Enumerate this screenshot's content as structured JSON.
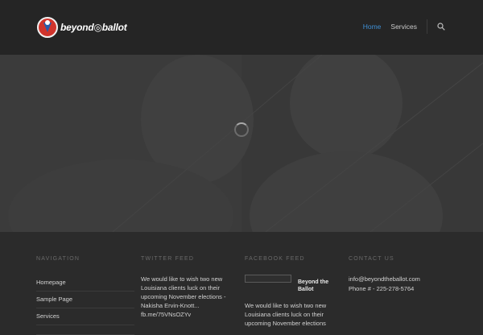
{
  "header": {
    "logo_text": "beyond◎ballot",
    "nav": [
      {
        "label": "Home",
        "active": true
      },
      {
        "label": "Services",
        "active": false
      }
    ],
    "accent": "#3f8fd4"
  },
  "footer": {
    "navigation": {
      "title": "NAVIGATION",
      "items": [
        "Homepage",
        "Sample Page",
        "Services",
        ""
      ]
    },
    "twitter": {
      "title": "TWITTER FEED",
      "text": "We would like to wish two new Louisiana clients luck on their upcoming November elections - Nakisha Ervin-Knott... fb.me/75VNsOZYv"
    },
    "facebook": {
      "title": "FACEBOOK FEED",
      "name": "Beyond the Ballot",
      "text": "We would like to wish two new Louisiana clients luck on their upcoming November elections"
    },
    "contact": {
      "title": "CONTACT US",
      "email": "info@beyondtheballot.com",
      "phone": "Phone # - 225-278-5764"
    }
  }
}
